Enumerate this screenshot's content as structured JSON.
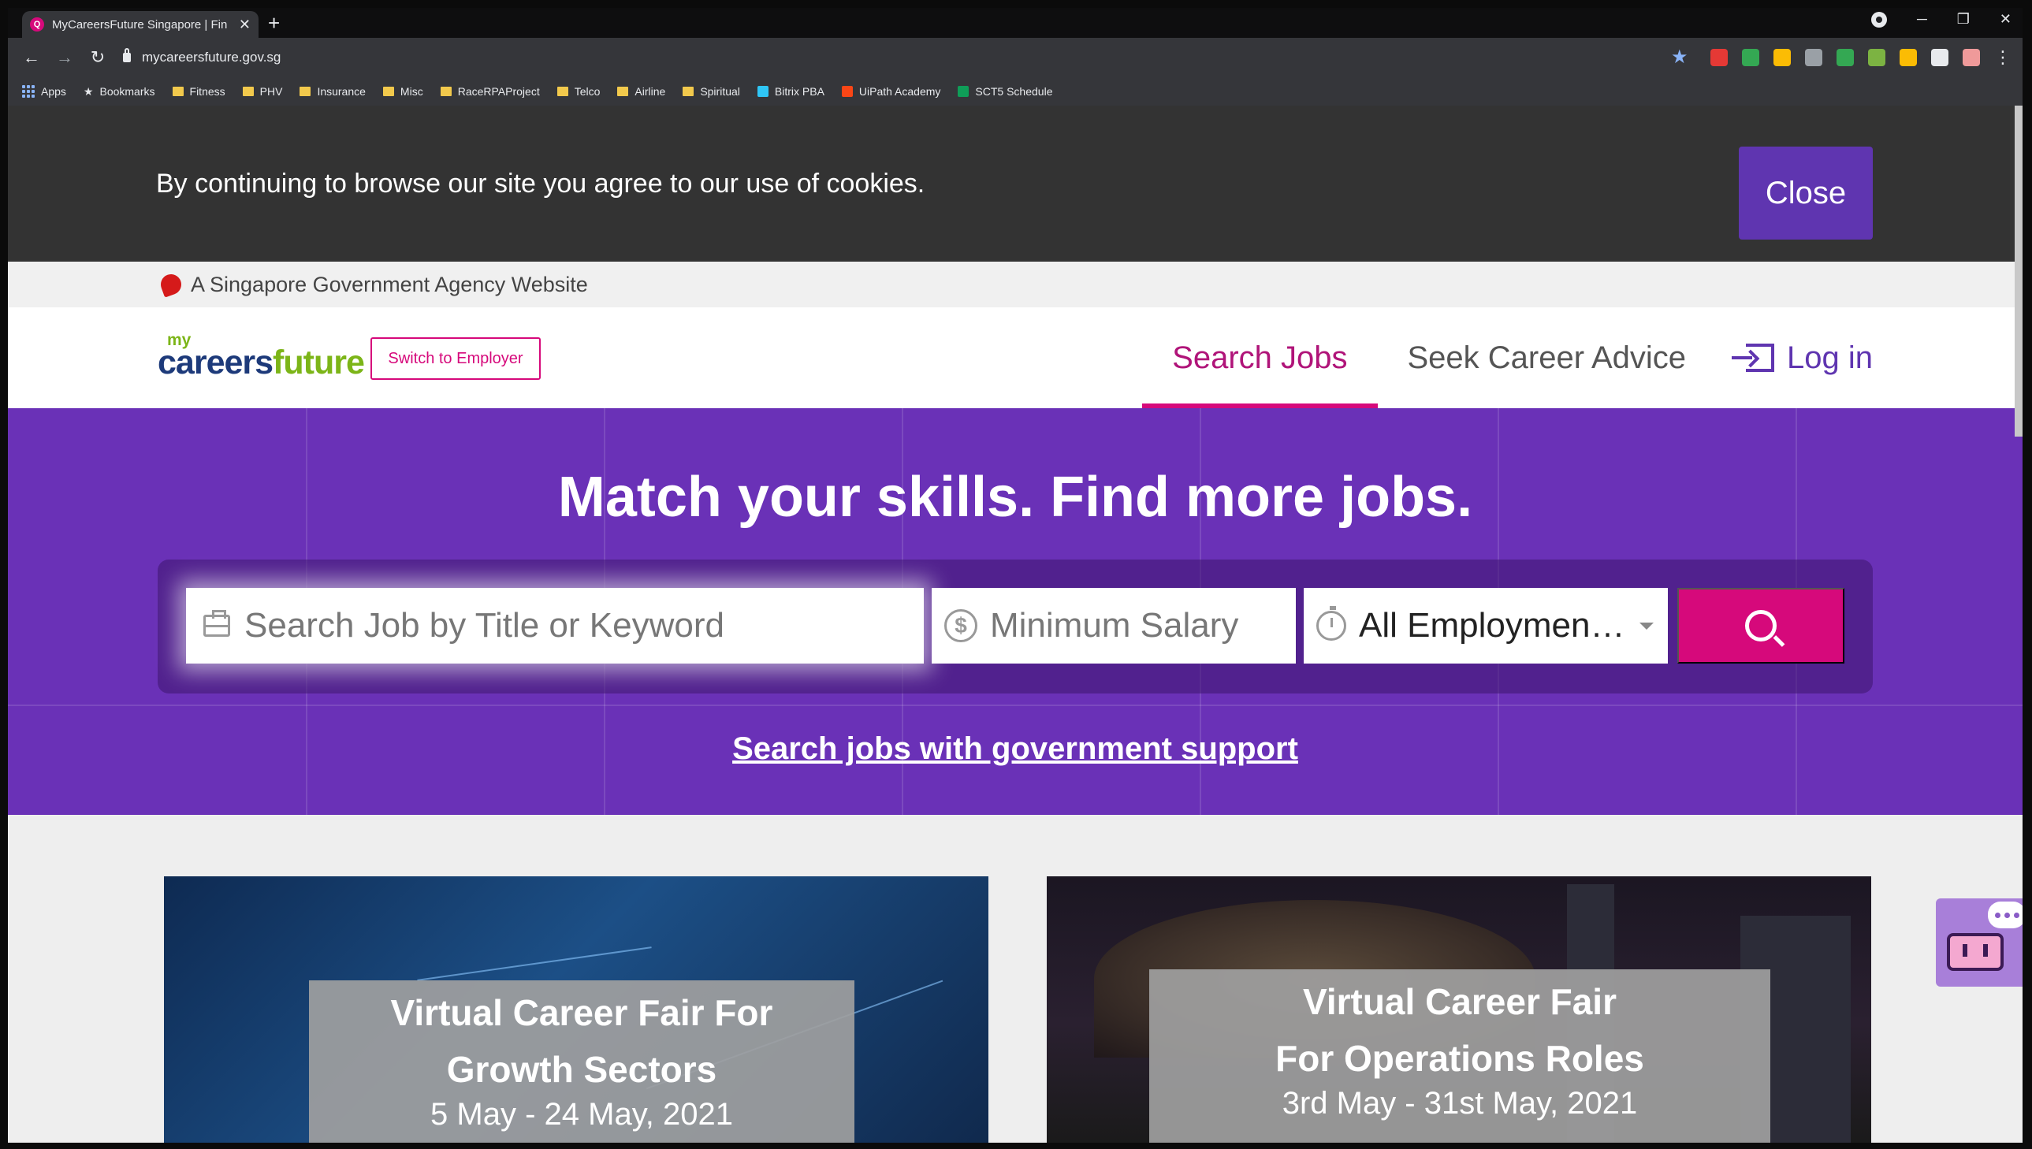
{
  "browser": {
    "tab_title": "MyCareersFuture Singapore | Fin",
    "new_tab_symbol": "+",
    "url": "mycareersfuture.gov.sg",
    "bookmarks": [
      {
        "label": "Apps",
        "icon": "apps-grid-icon"
      },
      {
        "label": "Bookmarks",
        "icon": "star-icon"
      },
      {
        "label": "Fitness",
        "icon": "folder-icon"
      },
      {
        "label": "PHV",
        "icon": "folder-icon"
      },
      {
        "label": "Insurance",
        "icon": "folder-icon"
      },
      {
        "label": "Misc",
        "icon": "folder-icon"
      },
      {
        "label": "RaceRPAProject",
        "icon": "folder-icon"
      },
      {
        "label": "Telco",
        "icon": "folder-icon"
      },
      {
        "label": "Airline",
        "icon": "folder-icon"
      },
      {
        "label": "Spiritual",
        "icon": "folder-icon"
      },
      {
        "label": "Bitrix PBA",
        "icon": "bitrix-icon"
      },
      {
        "label": "UiPath Academy",
        "icon": "uipath-icon"
      },
      {
        "label": "SCT5 Schedule",
        "icon": "sheets-icon"
      }
    ],
    "extension_colors": [
      "#e53935",
      "#34a853",
      "#fbbc04",
      "#9aa0a6",
      "#34a853",
      "#7cb342",
      "#fbbc04",
      "#e8eaed",
      "#ef9a9a"
    ]
  },
  "cookie_banner": {
    "text": "By continuing to browse our site you agree to our use of cookies.",
    "close_label": "Close"
  },
  "gov_bar": {
    "text": "A Singapore Government Agency Website"
  },
  "header": {
    "logo_my": "my",
    "logo_careers": "careers",
    "logo_future": "future",
    "switch_label": "Switch to Employer",
    "nav": {
      "search_jobs": "Search Jobs",
      "career_advice": "Seek Career Advice",
      "login": "Log in"
    }
  },
  "hero": {
    "title": "Match your skills. Find more jobs.",
    "keyword_placeholder": "Search Job by Title or Keyword",
    "salary_placeholder": "Minimum Salary",
    "employment_value": "All Employment...",
    "gov_support_link": "Search jobs with government support"
  },
  "cards": [
    {
      "title_line1": "Virtual Career Fair For",
      "title_line2": "Growth Sectors",
      "date": "5 May - 24 May, 2021"
    },
    {
      "title_line1": "Virtual Career Fair",
      "title_line2": "For Operations Roles",
      "date": "3rd May - 31st May, 2021"
    }
  ],
  "colors": {
    "brand_purple": "#6a31b7",
    "brand_magenta": "#d6097b",
    "cookie_bg": "#333333",
    "close_button": "#5f35b0"
  }
}
